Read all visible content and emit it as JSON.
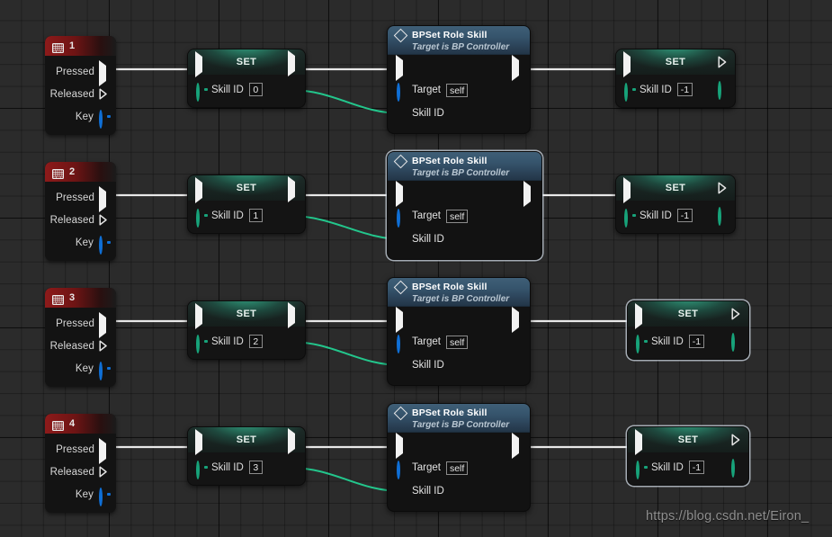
{
  "app": {
    "name": "unreal-blueprint-graph",
    "watermark": "https://blog.csdn.net/Eiron_"
  },
  "colors": {
    "canvas_bg": "#2b2b2b",
    "grid_minor": "#232323",
    "grid_major": "#141414",
    "event_header_red": "#8d1a1a",
    "set_header_teal": "#3ce6b4",
    "call_header_blue": "#3f5f77",
    "exec_wire": "#e8e8e8",
    "data_wire_green": "#23c68c",
    "pin_blue": "#0f6fd6",
    "pin_green": "#2fd79b",
    "pin_dark_green": "#17a37a"
  },
  "rows": [
    {
      "id": "row-1",
      "event": {
        "icon": "keyboard-icon",
        "title": "1",
        "pins": [
          {
            "label": "Pressed",
            "type": "exec",
            "connected": true
          },
          {
            "label": "Released",
            "type": "exec",
            "connected": false
          },
          {
            "label": "Key",
            "type": "data-blue",
            "connected": false
          }
        ]
      },
      "set_left": {
        "title": "SET",
        "pin_label": "Skill ID",
        "value": "0",
        "selected": false
      },
      "call": {
        "title": "BPSet Role Skill",
        "subtitle": "Target is BP Controller",
        "target_label": "Target",
        "target_value": "self",
        "skill_label": "Skill ID",
        "selected": false
      },
      "set_right": {
        "title": "SET",
        "pin_label": "Skill ID",
        "value": "-1",
        "selected": false
      }
    },
    {
      "id": "row-2",
      "event": {
        "icon": "keyboard-icon",
        "title": "2",
        "pins": [
          {
            "label": "Pressed",
            "type": "exec",
            "connected": true
          },
          {
            "label": "Released",
            "type": "exec",
            "connected": false
          },
          {
            "label": "Key",
            "type": "data-blue",
            "connected": false
          }
        ]
      },
      "set_left": {
        "title": "SET",
        "pin_label": "Skill ID",
        "value": "1",
        "selected": false
      },
      "call": {
        "title": "BPSet Role Skill",
        "subtitle": "Target is BP Controller",
        "target_label": "Target",
        "target_value": "self",
        "skill_label": "Skill ID",
        "selected": true
      },
      "set_right": {
        "title": "SET",
        "pin_label": "Skill ID",
        "value": "-1",
        "selected": false
      }
    },
    {
      "id": "row-3",
      "event": {
        "icon": "keyboard-icon",
        "title": "3",
        "pins": [
          {
            "label": "Pressed",
            "type": "exec",
            "connected": true
          },
          {
            "label": "Released",
            "type": "exec",
            "connected": false
          },
          {
            "label": "Key",
            "type": "data-blue",
            "connected": false
          }
        ]
      },
      "set_left": {
        "title": "SET",
        "pin_label": "Skill ID",
        "value": "2",
        "selected": false
      },
      "call": {
        "title": "BPSet Role Skill",
        "subtitle": "Target is BP Controller",
        "target_label": "Target",
        "target_value": "self",
        "skill_label": "Skill ID",
        "selected": false
      },
      "set_right": {
        "title": "SET",
        "pin_label": "Skill ID",
        "value": "-1",
        "selected": true
      }
    },
    {
      "id": "row-4",
      "event": {
        "icon": "keyboard-icon",
        "title": "4",
        "pins": [
          {
            "label": "Pressed",
            "type": "exec",
            "connected": true
          },
          {
            "label": "Released",
            "type": "exec",
            "connected": false
          },
          {
            "label": "Key",
            "type": "data-blue",
            "connected": false
          }
        ]
      },
      "set_left": {
        "title": "SET",
        "pin_label": "Skill ID",
        "value": "3",
        "selected": false
      },
      "call": {
        "title": "BPSet Role Skill",
        "subtitle": "Target is BP Controller",
        "target_label": "Target",
        "target_value": "self",
        "skill_label": "Skill ID",
        "selected": false
      },
      "set_right": {
        "title": "SET",
        "pin_label": "Skill ID",
        "value": "-1",
        "selected": true
      }
    }
  ]
}
